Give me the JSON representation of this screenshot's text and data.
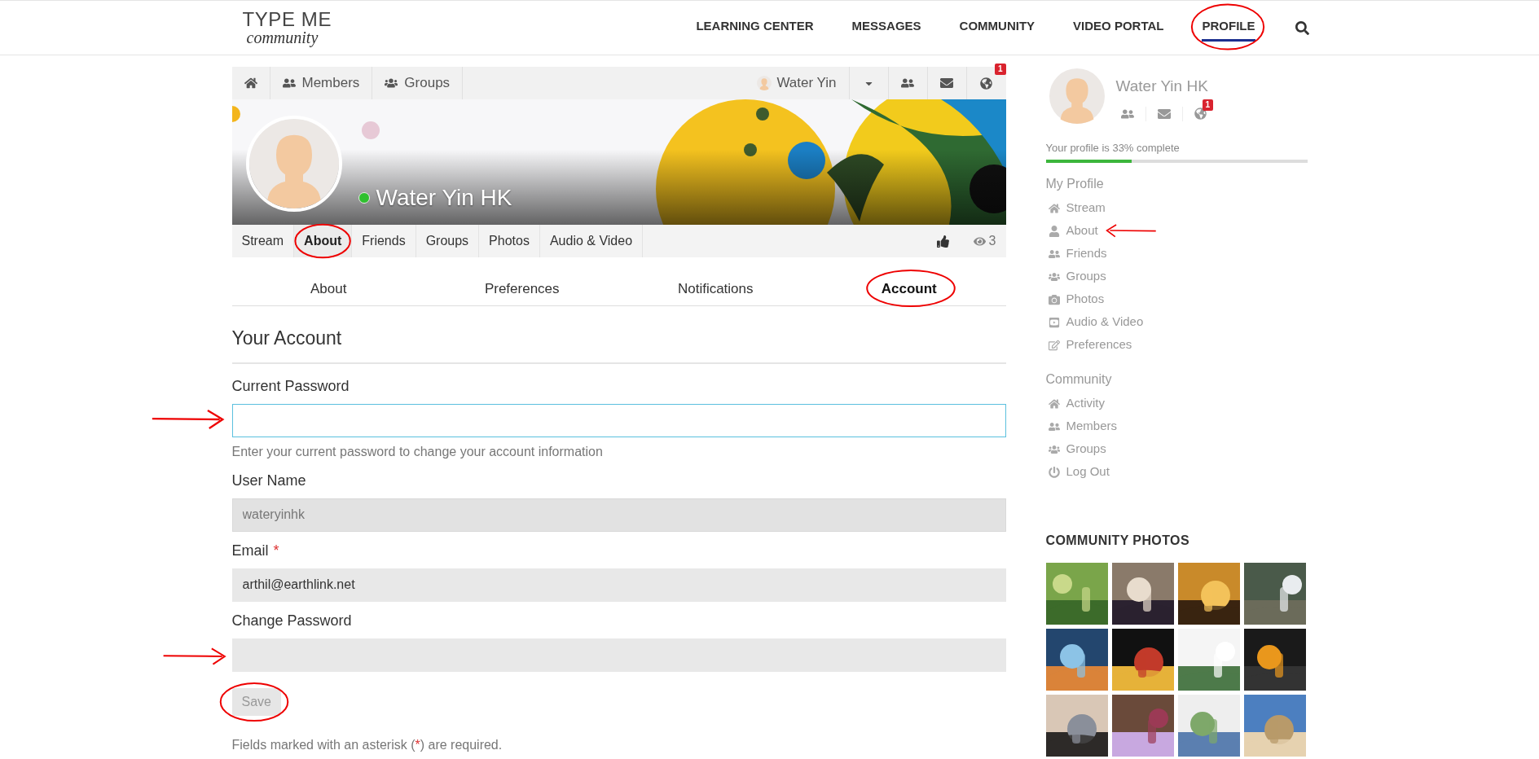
{
  "logo": {
    "line1": "TYPE ME",
    "line2": "community"
  },
  "nav": [
    {
      "label": "LEARNING CENTER",
      "selected": false
    },
    {
      "label": "MESSAGES",
      "selected": false
    },
    {
      "label": "COMMUNITY",
      "selected": false
    },
    {
      "label": "VIDEO PORTAL",
      "selected": false
    },
    {
      "label": "PROFILE",
      "selected": true
    }
  ],
  "toolbar": {
    "links": [
      {
        "kind": "home"
      },
      {
        "kind": "members",
        "label": "Members"
      },
      {
        "kind": "groups",
        "label": "Groups"
      }
    ],
    "user": "Water Yin",
    "badge": "1"
  },
  "cover": {
    "kind": "picture",
    "name": "Water Yin HK",
    "online": true
  },
  "profile_tabs": [
    {
      "label": "Stream",
      "selected": false
    },
    {
      "label": "About",
      "selected": true
    },
    {
      "label": "Friends",
      "selected": false
    },
    {
      "label": "Groups",
      "selected": false
    },
    {
      "label": "Photos",
      "selected": false
    },
    {
      "label": "Audio & Video",
      "selected": false
    }
  ],
  "views": "3",
  "sub_tabs": [
    {
      "label": "About",
      "selected": false
    },
    {
      "label": "Preferences",
      "selected": false
    },
    {
      "label": "Notifications",
      "selected": false
    },
    {
      "label": "Account",
      "selected": true
    }
  ],
  "form": {
    "title": "Your Account",
    "fields": [
      {
        "label": "Current Password",
        "focused": true,
        "disabled": false,
        "required": false,
        "help": "Enter your current password to change your account information"
      },
      {
        "label": "User Name",
        "value": "wateryinhk",
        "focused": false,
        "disabled": true,
        "required": false
      },
      {
        "label": "Email",
        "value": "arthil@earthlink.net",
        "focused": false,
        "disabled": false,
        "required": true
      },
      {
        "label": "Change Password",
        "focused": false,
        "disabled": false,
        "required": false
      }
    ],
    "required_mark": "*",
    "save": {
      "label": "Save",
      "disabled": true
    },
    "note": {
      "before": "Fields marked with an asterisk (",
      "mark": "*",
      "after": ") are required."
    }
  },
  "sidebar": {
    "name": "Water Yin HK",
    "badge": "1",
    "progress_text": "Your profile is 33% complete",
    "level": 0.33,
    "sections": [
      {
        "title": "My Profile",
        "items": [
          {
            "kind": "home",
            "label": "Stream"
          },
          {
            "kind": "user",
            "label": "About"
          },
          {
            "kind": "friends",
            "label": "Friends"
          },
          {
            "kind": "groups",
            "label": "Groups"
          },
          {
            "kind": "camera",
            "label": "Photos"
          },
          {
            "kind": "video",
            "label": "Audio & Video"
          },
          {
            "kind": "edit",
            "label": "Preferences"
          }
        ]
      },
      {
        "title": "Community",
        "items": [
          {
            "kind": "home",
            "label": "Activity"
          },
          {
            "kind": "friends",
            "label": "Members"
          },
          {
            "kind": "groups",
            "label": "Groups"
          },
          {
            "kind": "power",
            "label": "Log Out"
          }
        ]
      }
    ]
  },
  "community_photos": {
    "title": "COMMUNITY PHOTOS"
  }
}
